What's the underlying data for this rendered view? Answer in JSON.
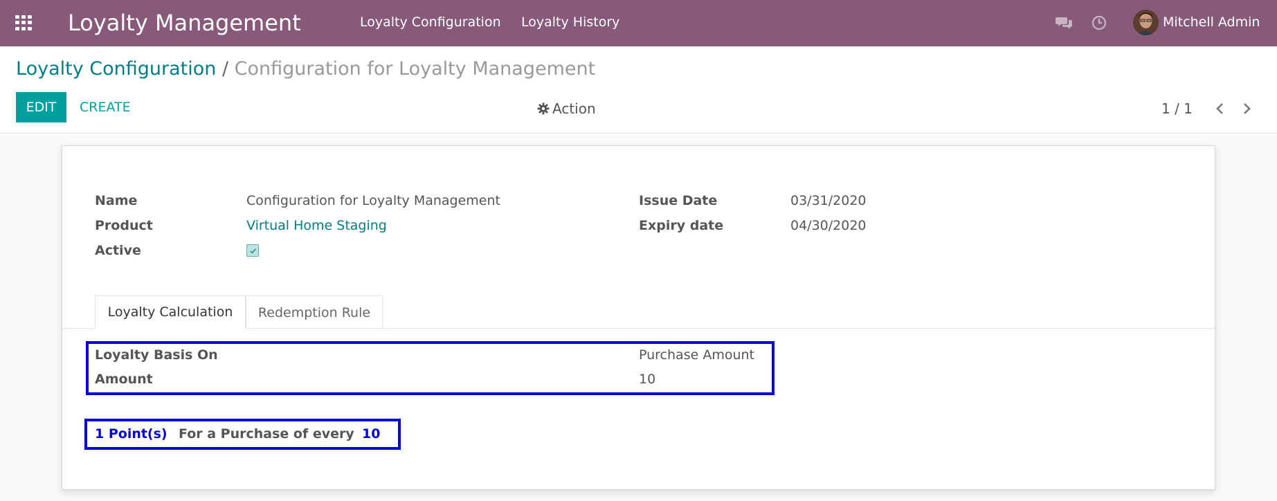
{
  "navbar": {
    "apps_icon": "apps-grid-icon",
    "brand": "Loyalty Management",
    "menu": [
      "Loyalty Configuration",
      "Loyalty History"
    ],
    "user": "Mitchell Admin",
    "color": "#875a7b"
  },
  "breadcrumb": {
    "parent": "Loyalty Configuration",
    "separator": "/",
    "current": "Configuration for Loyalty Management"
  },
  "buttons": {
    "edit": "EDIT",
    "create": "CREATE",
    "action": "Action"
  },
  "pager": {
    "value": "1 / 1"
  },
  "form": {
    "name_label": "Name",
    "name_value": "Configuration for Loyalty Management",
    "product_label": "Product",
    "product_value": "Virtual Home Staging",
    "active_label": "Active",
    "active_checked": true,
    "issue_date_label": "Issue Date",
    "issue_date_value": "03/31/2020",
    "expiry_date_label": "Expiry date",
    "expiry_date_value": "04/30/2020"
  },
  "tabs": [
    "Loyalty Calculation",
    "Redemption Rule"
  ],
  "calculation": {
    "basis_label": "Loyalty Basis On",
    "basis_value": "Purchase Amount",
    "amount_label": "Amount",
    "amount_value": "10",
    "points": "1 Point(s)",
    "phrase": "For a Purchase of every",
    "every_value": "10"
  },
  "colors": {
    "accent": "#00a09d",
    "highlight": "#0000dd"
  }
}
